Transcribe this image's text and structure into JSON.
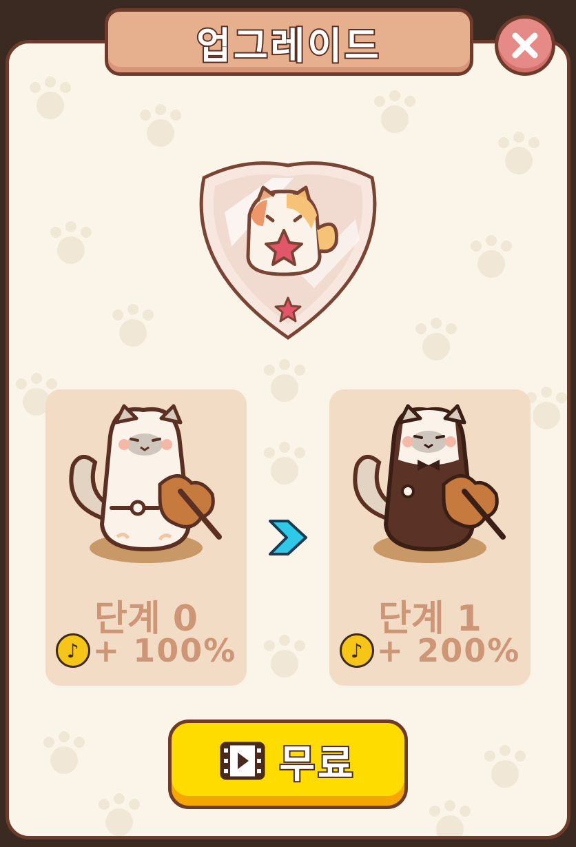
{
  "dialog": {
    "title": "업그레이드",
    "close_icon": "close-icon"
  },
  "badge": {
    "icon": "singing-cat-shield-icon",
    "star_icon": "star-icon"
  },
  "current_level": {
    "stage_label": "단계 0",
    "bonus": "+ 100%",
    "coin_icon": "music-note-coin-icon",
    "character_icon": "violin-cat-icon"
  },
  "next_level": {
    "stage_label": "단계 1",
    "bonus": "+ 200%",
    "coin_icon": "music-note-coin-icon",
    "character_icon": "violin-cat-tuxedo-icon"
  },
  "arrow_icon": "chevron-right-icon",
  "free_button": {
    "label": "무료",
    "icon": "video-film-icon"
  },
  "colors": {
    "border": "#6e3b2b",
    "panel": "#faf4e9",
    "card": "#f2dcc5",
    "button": "#ffdc00",
    "close": "#e58a86",
    "arrow": "#2ec8e8"
  }
}
